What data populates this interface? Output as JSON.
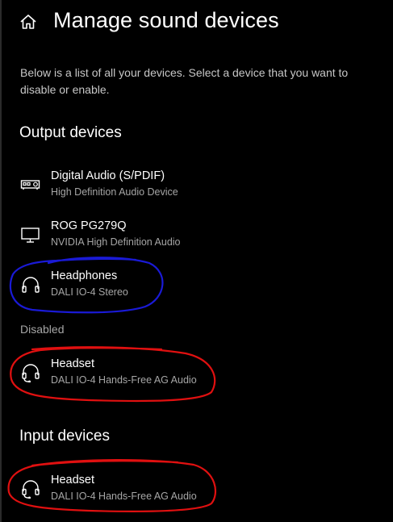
{
  "header": {
    "title": "Manage sound devices",
    "home_icon": "home-icon"
  },
  "description": "Below is a list of all your devices. Select a device that you want to disable or enable.",
  "output": {
    "heading": "Output devices",
    "devices": [
      {
        "name": "Digital Audio (S/PDIF)",
        "description": "High Definition Audio Device",
        "icon": "digital-audio-icon"
      },
      {
        "name": "ROG PG279Q",
        "description": "NVIDIA High Definition Audio",
        "icon": "monitor-icon"
      },
      {
        "name": "Headphones",
        "description": "DALI IO-4 Stereo",
        "icon": "headphones-icon"
      }
    ],
    "disabled_heading": "Disabled",
    "disabled_devices": [
      {
        "name": "Headset",
        "description": "DALI IO-4 Hands-Free AG Audio",
        "icon": "headset-icon"
      }
    ]
  },
  "input": {
    "heading": "Input devices",
    "devices": [
      {
        "name": "Headset",
        "description": "DALI IO-4 Hands-Free AG Audio",
        "icon": "headset-icon"
      }
    ]
  },
  "colors": {
    "background": "#000000",
    "text_primary": "#ffffff",
    "text_secondary": "#a6a6a6",
    "annotation_blue": "#1a1ad6",
    "annotation_red": "#e01010"
  }
}
